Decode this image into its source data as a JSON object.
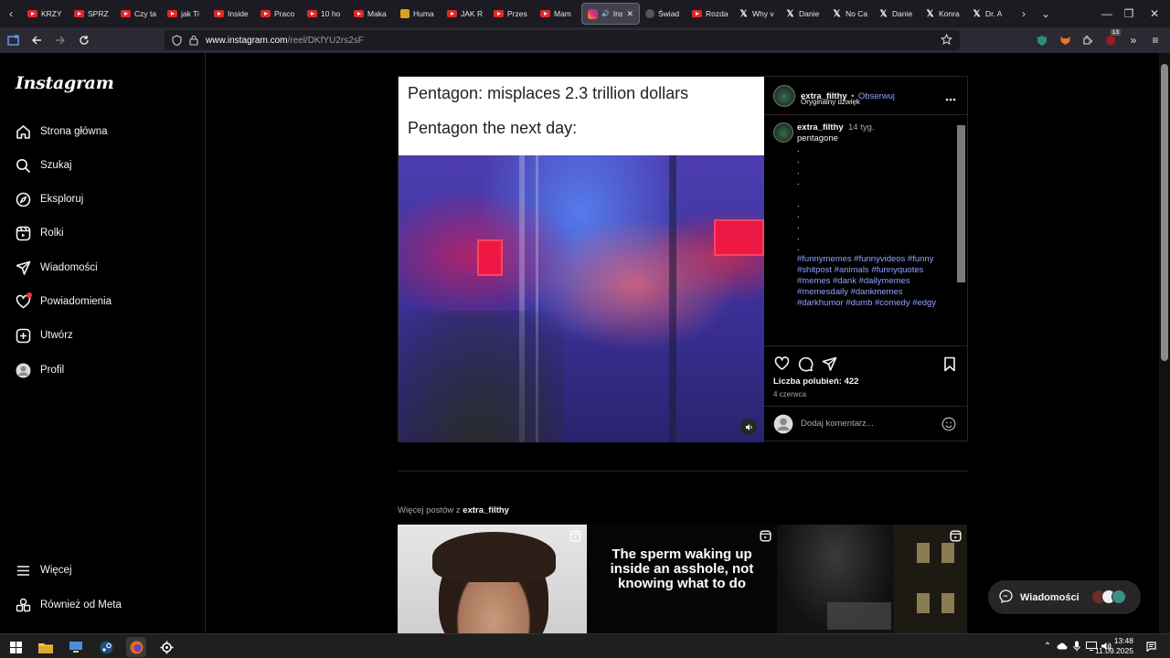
{
  "browser": {
    "tabs": [
      {
        "title": "KRZY",
        "favicon": "youtube"
      },
      {
        "title": "SPRZ",
        "favicon": "youtube"
      },
      {
        "title": "Czy ta",
        "favicon": "youtube"
      },
      {
        "title": "jak Ti",
        "favicon": "youtube"
      },
      {
        "title": "Inside",
        "favicon": "youtube"
      },
      {
        "title": "Praco",
        "favicon": "youtube"
      },
      {
        "title": "10 ho",
        "favicon": "youtube"
      },
      {
        "title": "Maka",
        "favicon": "youtube"
      },
      {
        "title": "Huma",
        "favicon": "generic-yellow"
      },
      {
        "title": "JAK R",
        "favicon": "youtube"
      },
      {
        "title": "Przes",
        "favicon": "youtube"
      },
      {
        "title": "Mam",
        "favicon": "youtube"
      },
      {
        "title": "Inst",
        "favicon": "instagram",
        "active": true
      },
      {
        "title": "Świad",
        "favicon": "generic"
      },
      {
        "title": "Rozda",
        "favicon": "youtube"
      },
      {
        "title": "Why v",
        "favicon": "x"
      },
      {
        "title": "Danie",
        "favicon": "x"
      },
      {
        "title": "No Ca",
        "favicon": "x"
      },
      {
        "title": "Danie",
        "favicon": "x"
      },
      {
        "title": "Konra",
        "favicon": "x"
      },
      {
        "title": "Dr. A",
        "favicon": "x"
      }
    ],
    "url_host": "www.instagram.com",
    "url_path": "/reel/DKfYU2rs2sF",
    "notification_count": "13"
  },
  "sidebar": {
    "logo": "Instagram",
    "items": [
      {
        "label": "Strona główna",
        "icon": "home-icon"
      },
      {
        "label": "Szukaj",
        "icon": "search-icon"
      },
      {
        "label": "Eksploruj",
        "icon": "compass-icon"
      },
      {
        "label": "Rolki",
        "icon": "reels-icon"
      },
      {
        "label": "Wiadomości",
        "icon": "send-icon"
      },
      {
        "label": "Powiadomienia",
        "icon": "heart-icon"
      },
      {
        "label": "Utwórz",
        "icon": "plus-icon"
      },
      {
        "label": "Profil",
        "icon": "profile-icon"
      }
    ],
    "bottom_items": [
      {
        "label": "Więcej",
        "icon": "menu-icon"
      },
      {
        "label": "Również od Meta",
        "icon": "meta-icon"
      }
    ]
  },
  "post": {
    "media_caption_line1": "Pentagon: misplaces 2.3 trillion dollars",
    "media_caption_line2": "Pentagon the next day:",
    "username": "extra_filthy",
    "follow_sep": "•",
    "follow_label": "Obserwuj",
    "audio": "Oryginalny dźwięk",
    "comment": {
      "username": "extra_filthy",
      "age": "14 tyg.",
      "text": "pentagone",
      "dots": [
        ".",
        ".",
        ".",
        ".",
        ".",
        ".",
        ".",
        ".",
        "."
      ],
      "hashtags": [
        "#funnymemes #funnyvideos #funny",
        "#shitpost #animals #funnyquotes",
        "#memes #dank #dailymemes",
        "#memesdaily  #dankmemes",
        "#darkhumor #dumb #comedy #edgy"
      ]
    },
    "likes": "Liczba polubień: 422",
    "date": "4 czerwca",
    "add_comment_placeholder": "Dodaj komentarz..."
  },
  "more_posts": {
    "label_prefix": "Więcej postów z",
    "label_user": "extra_filthy",
    "thumb2_text": "The sperm waking up inside an asshole, not knowing what to do"
  },
  "messages_pill": {
    "label": "Wiadomości"
  },
  "taskbar": {
    "time": "13:48",
    "date": "11.09.2025"
  }
}
